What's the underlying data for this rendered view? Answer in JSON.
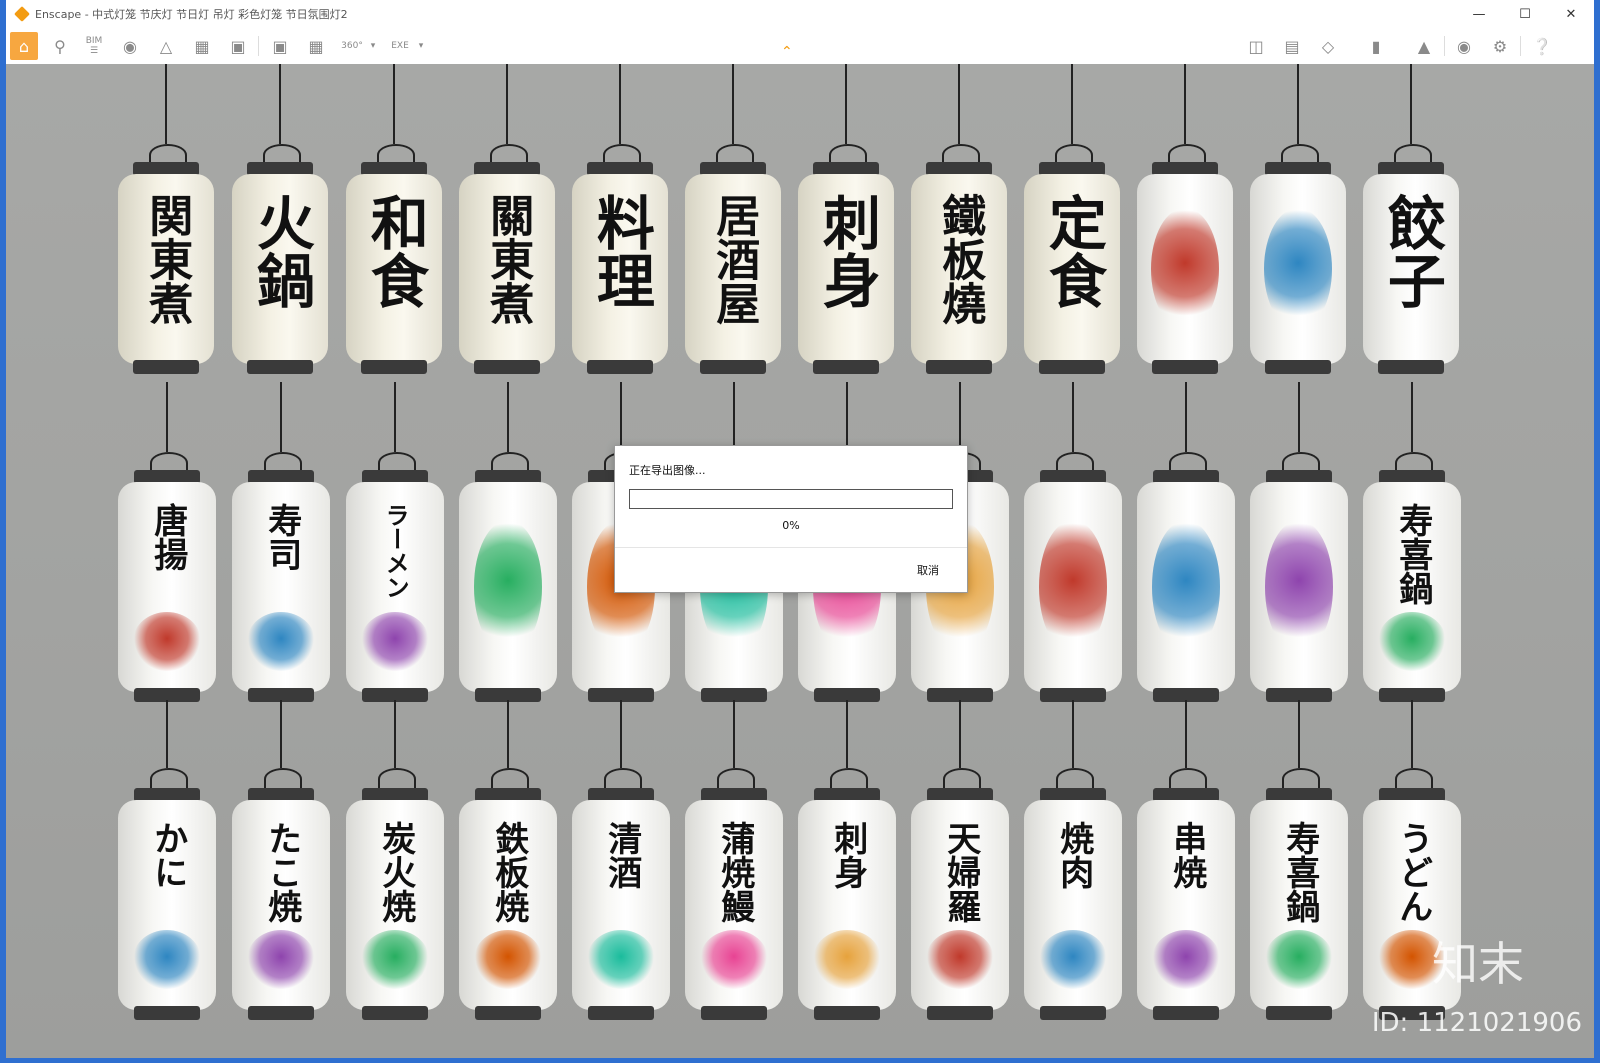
{
  "window": {
    "title": "Enscape - 中式灯笼 节庆灯 节日灯 吊灯 彩色灯笼 节日氛围灯2",
    "accent": "#f7a740"
  },
  "toolbar": {
    "left_icons": [
      "home-icon",
      "measure-icon",
      "bim-icon",
      "binoculars-icon",
      "perspective-icon",
      "buildings-icon",
      "clapper-icon",
      "screenshot-icon",
      "batch-render-icon",
      "panorama-icon",
      "exe-export-icon"
    ],
    "bim_label": "BIM",
    "panorama_label": "360°",
    "exe_label": "EXE",
    "right_icons": [
      "map-icon",
      "atlas-icon",
      "cube-icon",
      "books-icon",
      "hat-icon",
      "eye-icon",
      "gear-icon",
      "help-icon"
    ]
  },
  "dialog": {
    "title": "正在导出图像...",
    "progress": 0,
    "percent_text": "0%",
    "cancel_label": "取消"
  },
  "watermark": {
    "logo": "知末",
    "id_text": "ID: 1121021906"
  },
  "lanterns": {
    "row1": [
      {
        "text": "関東煮",
        "style": "cream"
      },
      {
        "text": "火鍋",
        "style": "cream"
      },
      {
        "text": "和食",
        "style": "cream"
      },
      {
        "text": "關東煮",
        "style": "cream"
      },
      {
        "text": "料理",
        "style": "cream"
      },
      {
        "text": "居酒屋",
        "style": "cream"
      },
      {
        "text": "刺身",
        "style": "cream"
      },
      {
        "text": "鐵板燒",
        "style": "cream"
      },
      {
        "text": "定食",
        "style": "cream"
      },
      {
        "text": "",
        "style": "white"
      },
      {
        "text": "",
        "style": "white"
      },
      {
        "text": "餃子",
        "style": "white"
      }
    ],
    "row2": [
      {
        "text": "唐揚",
        "style": "white"
      },
      {
        "text": "寿司",
        "style": "white"
      },
      {
        "text": "ラーメン",
        "style": "white"
      },
      {
        "text": "",
        "style": "white"
      },
      {
        "text": "",
        "style": "white"
      },
      {
        "text": "",
        "style": "white"
      },
      {
        "text": "",
        "style": "white"
      },
      {
        "text": "",
        "style": "white"
      },
      {
        "text": "",
        "style": "white"
      },
      {
        "text": "",
        "style": "white"
      },
      {
        "text": "",
        "style": "white"
      },
      {
        "text": "寿喜鍋",
        "style": "white"
      }
    ],
    "row3": [
      {
        "text": "かに",
        "style": "white"
      },
      {
        "text": "たこ焼",
        "style": "white"
      },
      {
        "text": "炭火焼",
        "style": "white"
      },
      {
        "text": "鉄板焼",
        "style": "white"
      },
      {
        "text": "清酒",
        "style": "white"
      },
      {
        "text": "蒲焼鰻",
        "style": "white"
      },
      {
        "text": "刺身",
        "style": "white"
      },
      {
        "text": "天婦羅",
        "style": "white"
      },
      {
        "text": "焼肉",
        "style": "white"
      },
      {
        "text": "串焼",
        "style": "white"
      },
      {
        "text": "寿喜鍋",
        "style": "white"
      },
      {
        "text": "うどん",
        "style": "white"
      }
    ]
  }
}
